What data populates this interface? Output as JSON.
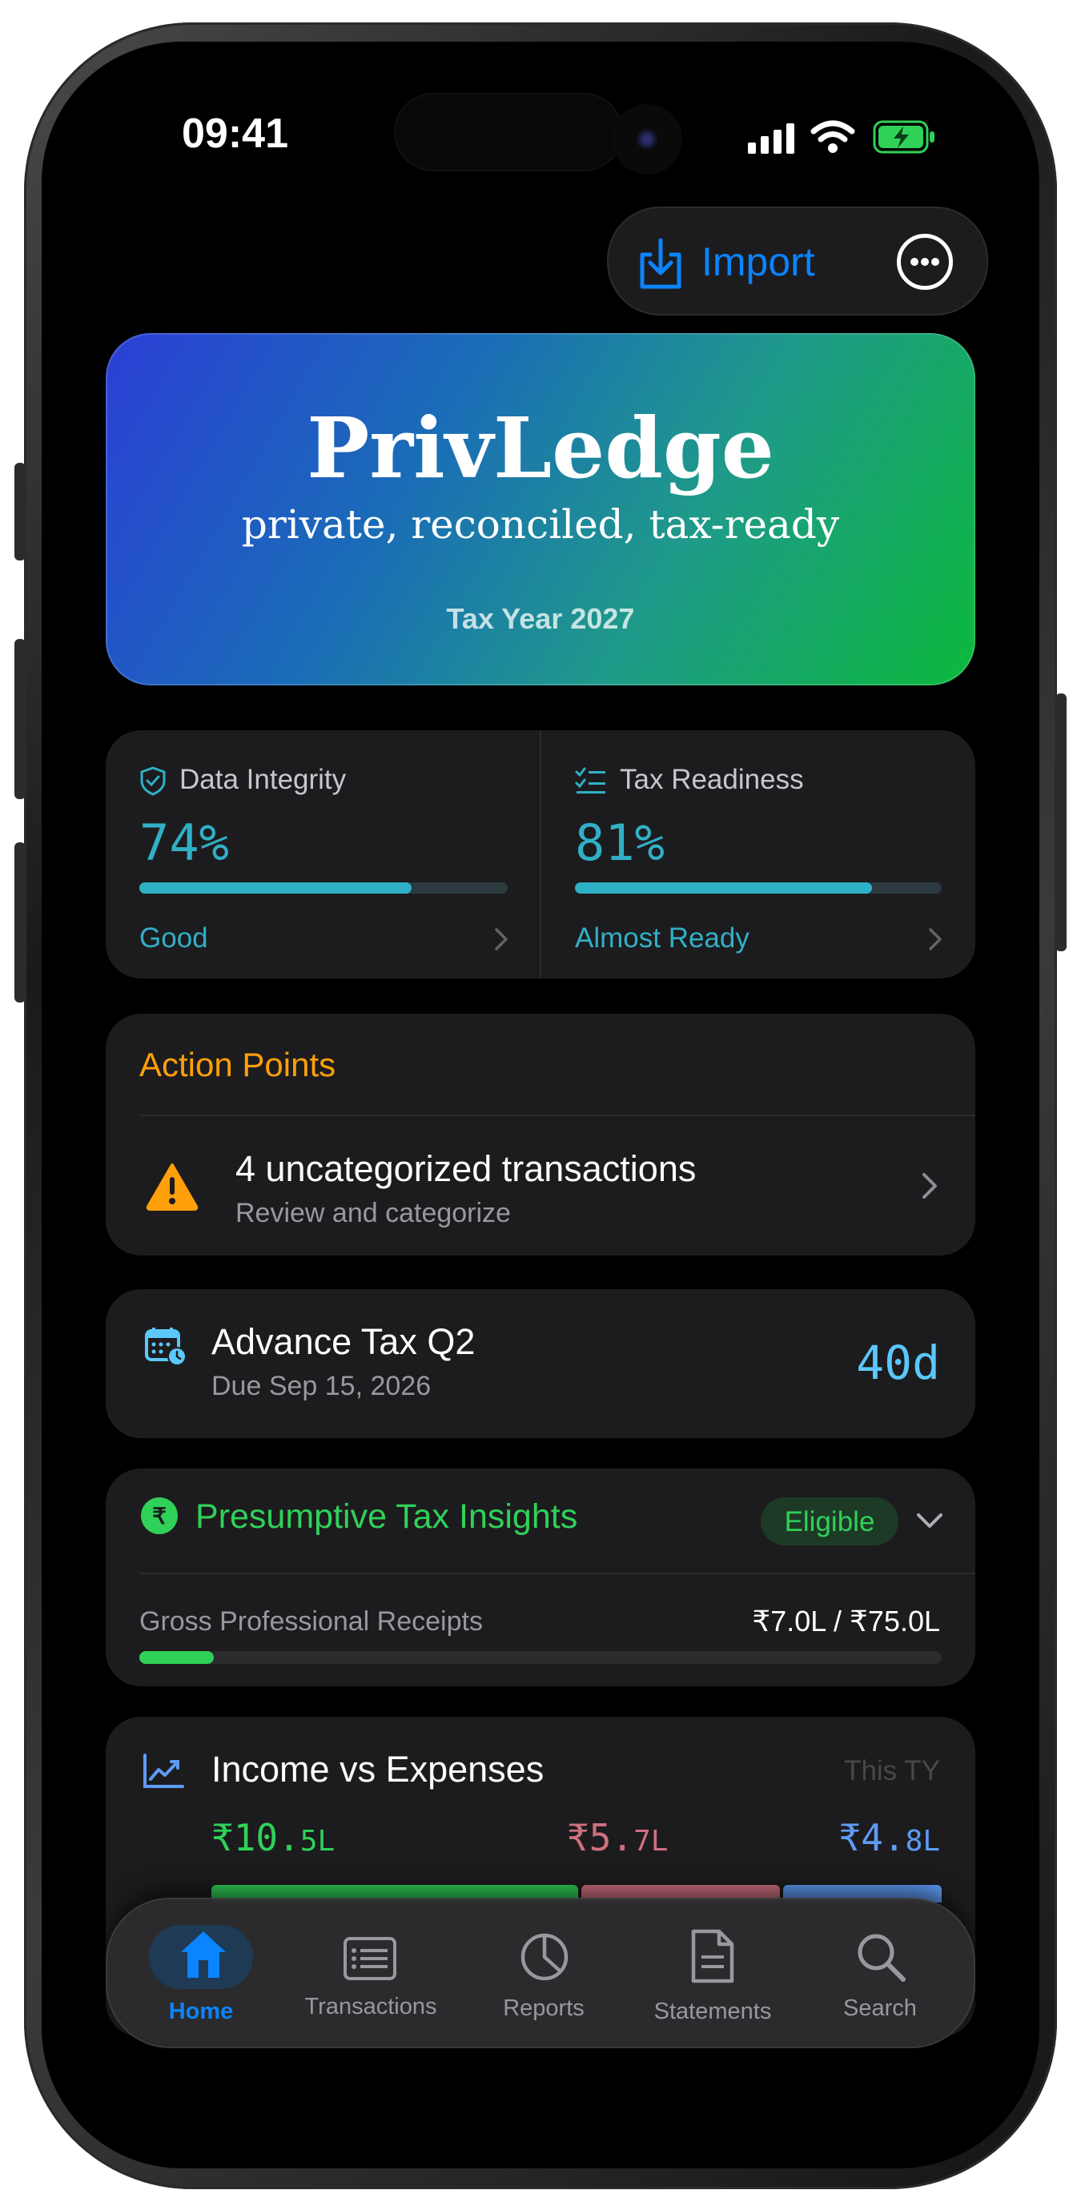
{
  "status_bar": {
    "time": "09:41"
  },
  "header": {
    "import_label": "Import"
  },
  "hero": {
    "title": "PrivLedge",
    "tagline": "private, reconciled, tax-ready",
    "tax_year": "Tax Year 2027"
  },
  "scores": {
    "integrity": {
      "label": "Data Integrity",
      "value": "74%",
      "level": 0.74,
      "status": "Good"
    },
    "readiness": {
      "label": "Tax Readiness",
      "value": "81%",
      "level": 0.81,
      "status": "Almost Ready"
    }
  },
  "action_points": {
    "title": "Action Points",
    "item": {
      "title": "4 uncategorized transactions",
      "subtitle": "Review and categorize"
    }
  },
  "advance_tax": {
    "title": "Advance Tax Q2",
    "due": "Due Sep 15, 2026",
    "countdown": "40d"
  },
  "presumptive": {
    "title": "Presumptive Tax Insights",
    "badge": "Eligible",
    "row_label": "Gross Professional Receipts",
    "row_value": "₹7.0L / ₹75.0L",
    "level": 0.093
  },
  "income_expenses": {
    "title": "Income vs Expenses",
    "period": "This TY",
    "income": {
      "main": "₹10.",
      "sub": "5L"
    },
    "expenses": {
      "main": "₹5.",
      "sub": "7L"
    },
    "net": {
      "main": "₹4.",
      "sub": "8L"
    }
  },
  "tabbar": {
    "home": "Home",
    "transactions": "Transactions",
    "reports": "Reports",
    "statements": "Statements",
    "search": "Search"
  },
  "colors": {
    "accent_blue": "#0a84ff",
    "teal": "#30b0c7",
    "orange": "#ff9f0a",
    "green": "#30d158",
    "red_muted": "#d0707f",
    "blue_muted": "#5e9bf5"
  }
}
